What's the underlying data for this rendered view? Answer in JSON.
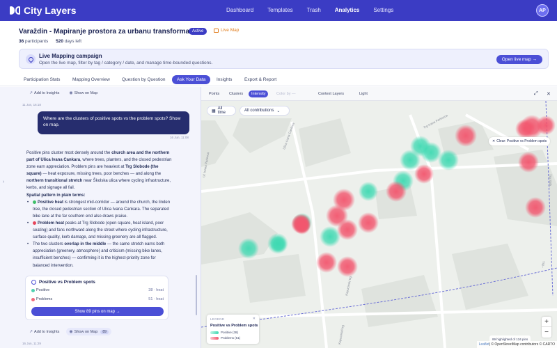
{
  "nav": {
    "logo": "City Layers",
    "links": [
      "Dashboard",
      "Templates",
      "Trash",
      "Analytics",
      "Settings"
    ],
    "active_link": "Analytics",
    "avatar": "AP"
  },
  "project": {
    "title": "Varaždin - Mapiranje prostora za urbanu transformaciju",
    "status": "Active",
    "live_map": "Live Map",
    "participants": "36",
    "participants_label": "participants",
    "days": "520",
    "days_label": "days left"
  },
  "banner": {
    "title": "Live Mapping campaign",
    "subtitle": "Open the live map, filter by tag / category / date, and manage time-bounded questions.",
    "button": "Open live map →"
  },
  "tabs": [
    "Participation Stats",
    "Mapping Overview",
    "Question by Question",
    "Ask Your Data",
    "Insights",
    "Export & Report"
  ],
  "chat": {
    "add_to_insights": "Add to Insights",
    "show_on_map": "Show on Map",
    "show_on_map_count": "89",
    "ts1": "11 Jun, 16:18",
    "question": "Where are the clusters of positive spots vs the problem spots? Show on map.",
    "ts2": "16 Jun, 11:08",
    "answer": {
      "intro": [
        "Positive pins cluster most densely around the ",
        "church area and the northern part of Ulica Ivana Cankara",
        ", where trees, planters, and the closed pedestrian zone earn appreciation. Problem pins are heaviest at ",
        "Trg Slobode (the square)",
        " — heat exposure, missing trees, poor benches — and along the ",
        "northern transitional stretch",
        " near Školska ulica where cycling infrastructure, kerbs, and signage all fail."
      ],
      "pattern_header": "Spatial pattern in plain terms:",
      "bullets": [
        {
          "bold": "Positive heat",
          "text": " is strongest mid-corridor — around the church, the linden tree, the closed pedestrian section of Ulica Ivana Cankara. The separated bike lane at the far southern end also draws praise."
        },
        {
          "bold": "Problem heat",
          "text": " peaks at Trg Slobode (open square, heat island, poor seating) and fans northward along the street where cycling infrastructure, surface quality, kerb damage, and missing greenery are all flagged."
        },
        {
          "pre": "The two clusters ",
          "bold": "overlap in the middle",
          "text": " — the same stretch earns both appreciation (greenery, atmosphere) and criticism (missing bike lanes, insufficient benches) — confirming it is the highest-priority zone for balanced intervention."
        }
      ]
    },
    "card": {
      "title": "Positive vs Problem spots",
      "rows": [
        {
          "label": "Positive",
          "value": "38 · heat",
          "color": "#4fd1b0"
        },
        {
          "label": "Problems",
          "value": "51 · heat",
          "color": "#f06a7c"
        }
      ],
      "button": "Show 89 pins on map →"
    },
    "ts3": "16 Jun, 11:29"
  },
  "map": {
    "modes": [
      "Points",
      "Clusters",
      "Intensity",
      "Color by —",
      "Context Layers",
      "Light"
    ],
    "active_mode": "Intensity",
    "time_filter": "All time",
    "contrib_filter": "All contributions",
    "clear": "Clear: Positive vs Problem spots",
    "legend": {
      "head": "LEGEND",
      "title": "Positive vs Problem spots",
      "rows": [
        {
          "label": "Positive (38)",
          "color": "#4fd1b0"
        },
        {
          "label": "Problems (51)",
          "color": "#f06a7c"
        }
      ]
    },
    "highlighted": "89 highlighted of 134 pins",
    "zoom_in": "+",
    "zoom_out": "−",
    "attribution_leaflet": "Leaflet",
    "attribution_rest": " | © OpenStreetMap contributors © CARTO",
    "streets": [
      "Trg Ivana Perkovca",
      "Kapucinski trg",
      "Kapucinski trg",
      "Ul. Ivana Padovca",
      "Ulica Ivana Cankara",
      "Trg Slob...",
      "Trg..."
    ]
  }
}
